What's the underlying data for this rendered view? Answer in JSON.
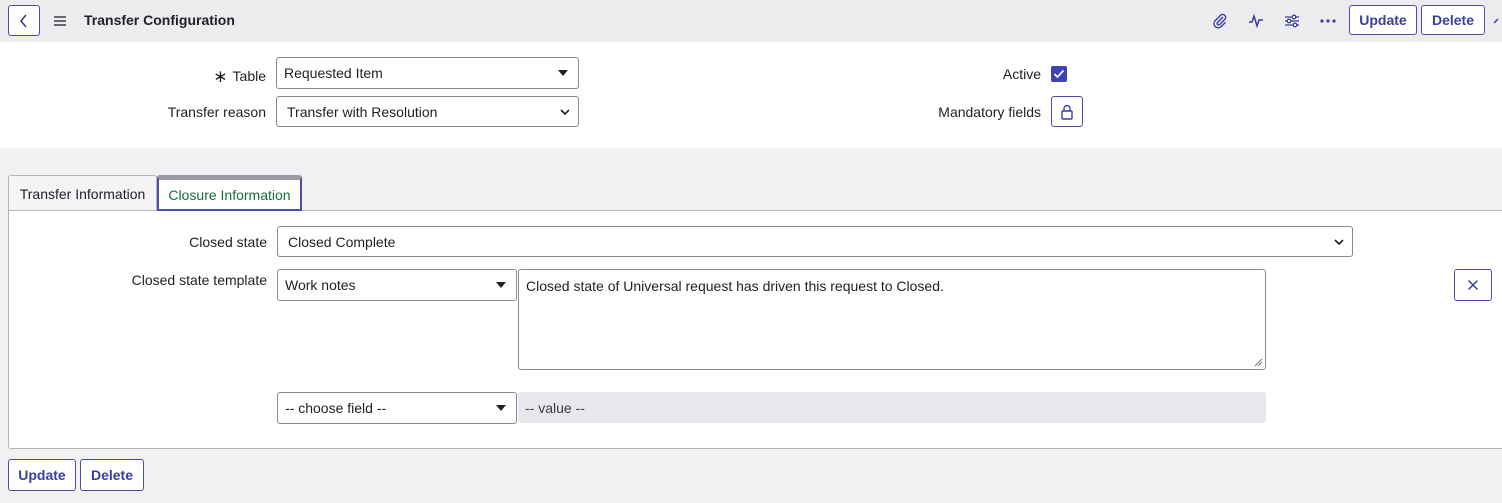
{
  "header": {
    "title": "Transfer Configuration",
    "update_label": "Update",
    "delete_label": "Delete"
  },
  "form": {
    "table_label": "Table",
    "table_value": "Requested Item",
    "transfer_reason_label": "Transfer reason",
    "transfer_reason_value": "Transfer with Resolution",
    "active_label": "Active",
    "active_checked": true,
    "mandatory_fields_label": "Mandatory fields"
  },
  "tabs": [
    {
      "label": "Transfer Information",
      "selected": false
    },
    {
      "label": "Closure Information",
      "selected": true
    }
  ],
  "closure": {
    "closed_state_label": "Closed state",
    "closed_state_value": "Closed Complete",
    "template_label": "Closed state template",
    "template_field_value": "Work notes",
    "template_text": "Closed state of Universal request has driven this request to Closed.",
    "choose_field_value": "-- choose field --",
    "value_placeholder": "-- value --"
  },
  "footer": {
    "update_label": "Update",
    "delete_label": "Delete"
  },
  "colors": {
    "accent": "#3a3f9c",
    "tab_selected_text": "#1a6b3c",
    "background": "#f1f1f3"
  }
}
